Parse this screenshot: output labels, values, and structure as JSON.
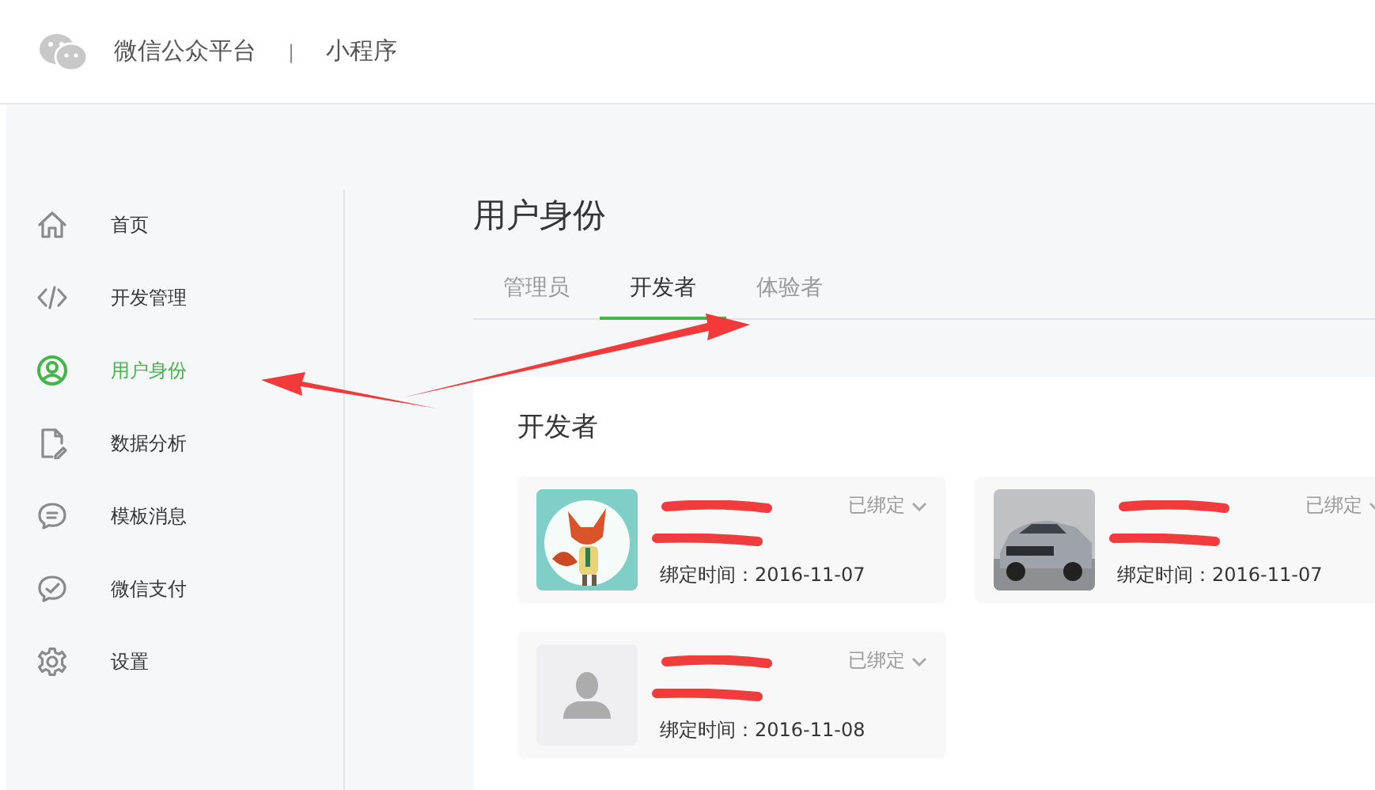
{
  "header": {
    "title": "微信公众平台",
    "separator": "|",
    "subtitle": "小程序"
  },
  "sidebar": {
    "items": [
      {
        "label": "首页",
        "selected": false
      },
      {
        "label": "开发管理",
        "selected": false
      },
      {
        "label": "用户身份",
        "selected": true
      },
      {
        "label": "数据分析",
        "selected": false
      },
      {
        "label": "模板消息",
        "selected": false
      },
      {
        "label": "微信支付",
        "selected": false
      },
      {
        "label": "设置",
        "selected": false
      }
    ]
  },
  "page_title": "用户身份",
  "tabs": [
    {
      "label": "管理员",
      "selected": false
    },
    {
      "label": "开发者",
      "selected": true
    },
    {
      "label": "体验者",
      "selected": false
    }
  ],
  "panel": {
    "title": "开发者",
    "members": [
      {
        "kind": "picture",
        "status": "已绑定",
        "bind_time": "绑定时间：2016-11-07"
      },
      {
        "kind": "picture",
        "status": "已绑定",
        "bind_time": "绑定时间：2016-11-07"
      },
      {
        "kind": "default",
        "status": "已绑定",
        "bind_time": "绑定时间：2016-11-08"
      }
    ]
  }
}
